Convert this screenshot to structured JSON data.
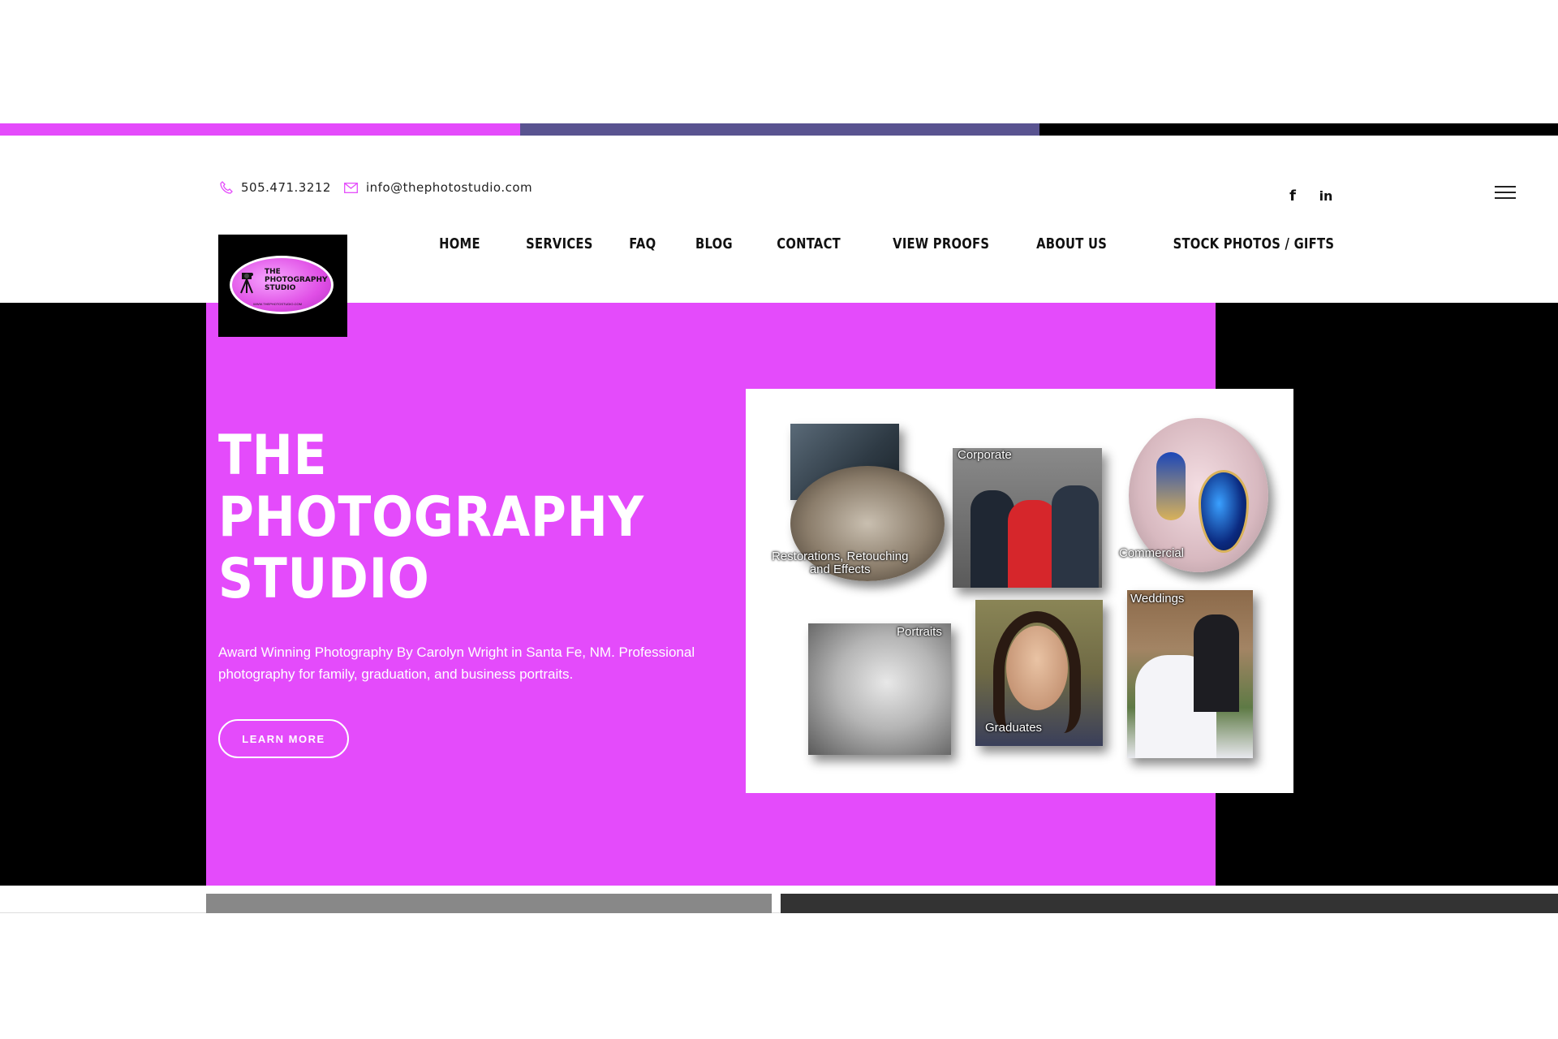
{
  "stripe": {
    "colors": [
      "#e44bfb",
      "#595390",
      "#000000"
    ]
  },
  "contact": {
    "phone": "505.471.3212",
    "email": "info@thephotostudio.com",
    "accent_color": "#e44bfb"
  },
  "social": [
    {
      "icon": "facebook-icon",
      "glyph": "f"
    },
    {
      "icon": "linkedin-icon",
      "glyph": "in"
    }
  ],
  "menu_icon": "hamburger-menu-icon",
  "logo": {
    "line1": "THE",
    "line2": "PHOTOGRAPHY",
    "line3": "STUDIO",
    "url": "WWW.THEPHOTOSTUDIO.COM"
  },
  "nav": [
    {
      "label": "HOME"
    },
    {
      "label": "SERVICES"
    },
    {
      "label": "FAQ"
    },
    {
      "label": "BLOG"
    },
    {
      "label": "CONTACT"
    },
    {
      "label": "VIEW PROOFS"
    },
    {
      "label": "ABOUT US"
    },
    {
      "label": "STOCK PHOTOS / GIFTS"
    }
  ],
  "hero": {
    "title_line1": "THE",
    "title_line2": "PHOTOGRAPHY",
    "title_line3": "STUDIO",
    "description": "Award Winning Photography By Carolyn Wright in Santa Fe, NM. Professional photography for family, graduation, and business portraits.",
    "button": "LEARN MORE",
    "panel_color": "#e44bfb"
  },
  "collage": {
    "restorations": "Restorations, Retouching",
    "restorations2": "and Effects",
    "corporate": "Corporate",
    "commercial": "Commercial",
    "portraits": "Portraits",
    "graduates": "Graduates",
    "weddings": "Weddings"
  },
  "bottom_bars": {
    "colors": [
      "#888888",
      "#333333"
    ]
  }
}
